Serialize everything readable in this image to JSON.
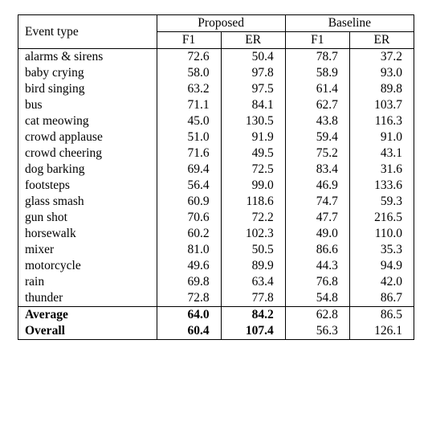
{
  "chart_data": {
    "type": "table",
    "title": "",
    "columns": [
      "Event type",
      "Proposed F1",
      "Proposed ER",
      "Baseline F1",
      "Baseline ER"
    ],
    "rows": [
      [
        "alarms & sirens",
        72.6,
        50.4,
        78.7,
        37.2
      ],
      [
        "baby crying",
        58.0,
        97.8,
        58.9,
        93.0
      ],
      [
        "bird singing",
        63.2,
        97.5,
        61.4,
        89.8
      ],
      [
        "bus",
        71.1,
        84.1,
        62.7,
        103.7
      ],
      [
        "cat meowing",
        45.0,
        130.5,
        43.8,
        116.3
      ],
      [
        "crowd applause",
        51.0,
        91.9,
        59.4,
        91.0
      ],
      [
        "crowd cheering",
        71.6,
        49.5,
        75.2,
        43.1
      ],
      [
        "dog barking",
        69.4,
        72.5,
        83.4,
        31.6
      ],
      [
        "footsteps",
        56.4,
        99.0,
        46.9,
        133.6
      ],
      [
        "glass smash",
        60.9,
        118.6,
        74.7,
        59.3
      ],
      [
        "gun shot",
        70.6,
        72.2,
        47.7,
        216.5
      ],
      [
        "horsewalk",
        60.2,
        102.3,
        49.0,
        110.0
      ],
      [
        "mixer",
        81.0,
        50.5,
        86.6,
        35.3
      ],
      [
        "motorcycle",
        49.6,
        89.9,
        44.3,
        94.9
      ],
      [
        "rain",
        69.8,
        63.4,
        76.8,
        42.0
      ],
      [
        "thunder",
        72.8,
        77.8,
        54.8,
        86.7
      ]
    ],
    "summary": [
      {
        "label": "Average",
        "values": [
          64.0,
          84.2,
          62.8,
          86.5
        ],
        "bold_cols": [
          0,
          1,
          2
        ]
      },
      {
        "label": "Overall",
        "values": [
          60.4,
          107.4,
          56.3,
          126.1
        ],
        "bold_cols": [
          0,
          1,
          2
        ]
      }
    ]
  },
  "header": {
    "event_type": "Event type",
    "proposed": "Proposed",
    "baseline": "Baseline",
    "f1": "F1",
    "er": "ER"
  }
}
